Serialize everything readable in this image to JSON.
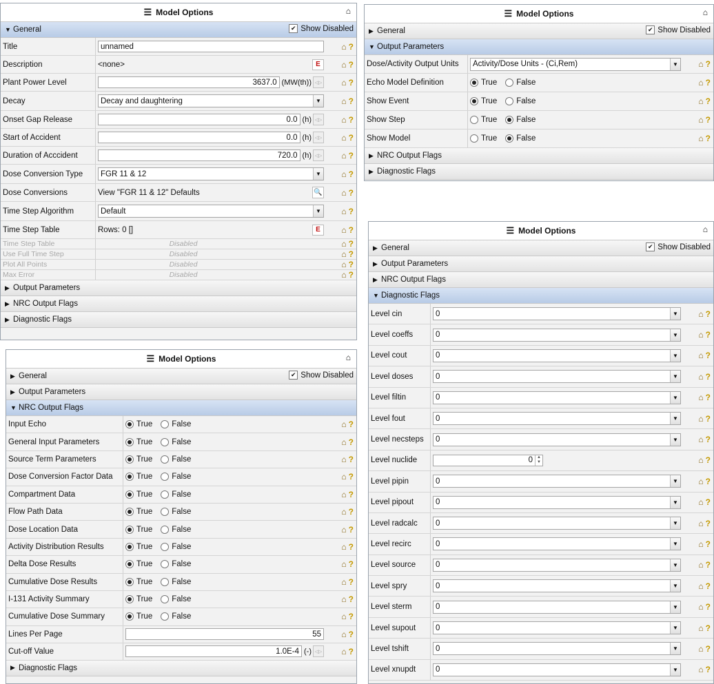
{
  "panel_title": "Model Options",
  "show_disabled_label": "Show Disabled",
  "sections": {
    "general": "General",
    "output_params": "Output Parameters",
    "nrc_flags": "NRC Output Flags",
    "diag_flags": "Diagnostic Flags"
  },
  "radio": {
    "true": "True",
    "false": "False"
  },
  "general": {
    "title": {
      "label": "Title",
      "value": "unnamed"
    },
    "description": {
      "label": "Description",
      "value": "<none>"
    },
    "plant_power": {
      "label": "Plant Power Level",
      "value": "3637.0",
      "unit": "(MW(th))"
    },
    "decay": {
      "label": "Decay",
      "value": "Decay and daughtering"
    },
    "onset_gap": {
      "label": "Onset Gap Release",
      "value": "0.0",
      "unit": "(h)"
    },
    "start_accident": {
      "label": "Start of Accident",
      "value": "0.0",
      "unit": "(h)"
    },
    "duration": {
      "label": "Duration of Acccident",
      "value": "720.0",
      "unit": "(h)"
    },
    "dose_conv_type": {
      "label": "Dose Conversion Type",
      "value": "FGR 11 & 12"
    },
    "dose_conversions": {
      "label": "Dose Conversions",
      "value": "View \"FGR 11 & 12\" Defaults"
    },
    "time_step_alg": {
      "label": "Time Step Algorithm",
      "value": "Default"
    },
    "time_step_table": {
      "label": "Time Step Table",
      "value": "Rows: 0 []"
    },
    "disabled_text": "Disabled",
    "disabled_rows": [
      "Time Step Table",
      "Use Full Time Step",
      "Plot All Points",
      "Max Error"
    ]
  },
  "output": {
    "rows": [
      {
        "label": "Dose/Activity Output Units",
        "type": "combo",
        "value": "Activity/Dose Units - (Ci,Rem)"
      },
      {
        "label": "Echo Model Definition",
        "type": "radio",
        "selected": "true"
      },
      {
        "label": "Show Event",
        "type": "radio",
        "selected": "true"
      },
      {
        "label": "Show Step",
        "type": "radio",
        "selected": "false"
      },
      {
        "label": "Show Model",
        "type": "radio",
        "selected": "false"
      }
    ]
  },
  "nrc": {
    "rows": [
      "Input Echo",
      "General Input Parameters",
      "Source Term Parameters",
      "Dose Conversion Factor Data",
      "Compartment Data",
      "Flow Path Data",
      "Dose Location Data",
      "Activity Distribution Results",
      "Delta Dose Results",
      "Cumulative Dose Results",
      "I-131 Activity Summary",
      "Cumulative Dose Summary"
    ],
    "lines_per_page": {
      "label": "Lines Per Page",
      "value": "55"
    },
    "cutoff": {
      "label": "Cut-off Value",
      "value": "1.0E-4",
      "unit": "(-)"
    }
  },
  "diag": {
    "rows": [
      {
        "label": "Level cin",
        "value": "0",
        "type": "combo"
      },
      {
        "label": "Level coeffs",
        "value": "0",
        "type": "combo"
      },
      {
        "label": "Level cout",
        "value": "0",
        "type": "combo"
      },
      {
        "label": "Level doses",
        "value": "0",
        "type": "combo"
      },
      {
        "label": "Level filtin",
        "value": "0",
        "type": "combo"
      },
      {
        "label": "Level fout",
        "value": "0",
        "type": "combo"
      },
      {
        "label": "Level necsteps",
        "value": "0",
        "type": "combo"
      },
      {
        "label": "Level nuclide",
        "value": "0",
        "type": "spin"
      },
      {
        "label": "Level pipin",
        "value": "0",
        "type": "combo"
      },
      {
        "label": "Level pipout",
        "value": "0",
        "type": "combo"
      },
      {
        "label": "Level radcalc",
        "value": "0",
        "type": "combo"
      },
      {
        "label": "Level recirc",
        "value": "0",
        "type": "combo"
      },
      {
        "label": "Level source",
        "value": "0",
        "type": "combo"
      },
      {
        "label": "Level spry",
        "value": "0",
        "type": "combo"
      },
      {
        "label": "Level sterm",
        "value": "0",
        "type": "combo"
      },
      {
        "label": "Level supout",
        "value": "0",
        "type": "combo"
      },
      {
        "label": "Level tshift",
        "value": "0",
        "type": "combo"
      },
      {
        "label": "Level xnupdt",
        "value": "0",
        "type": "combo"
      }
    ]
  }
}
